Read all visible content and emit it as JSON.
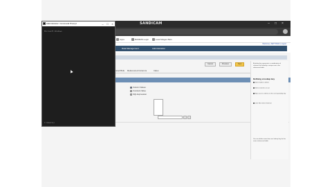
{
  "browser": {
    "tabs": [
      "SANDICAM",
      "Add Subscription"
    ],
    "watermark": "SANDICAM",
    "watermark_suffix": "www.bandicam.com",
    "bookmarks": [
      "Apps",
      "BAMIMS Login",
      "Lead Wages Bars"
    ]
  },
  "app": {
    "nav": [
      "Data Management",
      "Administration"
    ],
    "top_links": "Welcome | SETTINGS | Logout",
    "toolbar": {
      "btn1": "Cancel",
      "btn2": "Previous",
      "btn3": "Next"
    },
    "detail_tabs": [
      "Advanced Bids",
      "Referenced Columns",
      "Indes"
    ],
    "radios": [
      {
        "label": "Column Values",
        "selected": true
      },
      {
        "label": "Constant Value",
        "selected": false
      },
      {
        "label": "SQL Expression",
        "selected": false
      }
    ]
  },
  "help": {
    "title": "Defining a lookup key",
    "intro": "A lookup key represents a combination of columns that identify a unique row in the referenced table.",
    "steps": [
      "Select table to define",
      "Select columns to use",
      "Map source columns to the corresponding key",
      "Click Next when finished"
    ],
    "footer": "You can define more than one lookup key for the same referenced table."
  },
  "cmd": {
    "title": "Administrator: Command Prompt",
    "line1": "Microsoft Windows",
    "prompt": "C:\\Users\\>"
  },
  "colors": {
    "nav": "#31506e",
    "accent": "#f3c64a",
    "section": "#6d8fb5"
  }
}
